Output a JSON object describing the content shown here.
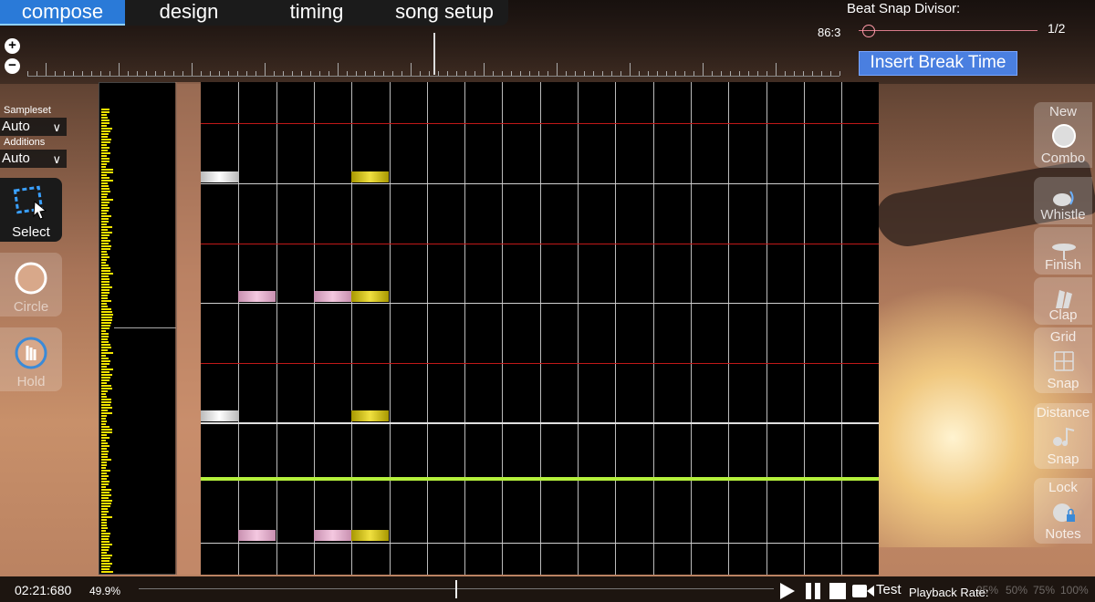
{
  "mode_tabs": [
    {
      "label": "compose",
      "active": true
    },
    {
      "label": "design",
      "active": false
    },
    {
      "label": "timing",
      "active": false
    },
    {
      "label": "song setup",
      "active": false
    }
  ],
  "beat_snap": {
    "title": "Beat Snap Divisor:",
    "bpm": "86:3",
    "value": "1/2"
  },
  "insert_break": "Insert Break Time",
  "zoom": {
    "in": "+",
    "out": "−"
  },
  "left_panel": {
    "sampleset_label": "Sampleset",
    "sampleset_value": "Auto",
    "additions_label": "Additions",
    "additions_value": "Auto",
    "tools": [
      {
        "label": "Select",
        "icon": "select-icon",
        "active": true
      },
      {
        "label": "Circle",
        "icon": "circle-icon",
        "active": false
      },
      {
        "label": "Hold",
        "icon": "hold-icon",
        "active": false
      }
    ]
  },
  "right_panel": {
    "tools": [
      {
        "top": "New",
        "bottom": "Combo",
        "icon": "new-combo-icon"
      },
      {
        "top": "",
        "bottom": "Whistle",
        "icon": "whistle-icon"
      },
      {
        "top": "",
        "bottom": "Finish",
        "icon": "finish-icon"
      },
      {
        "top": "",
        "bottom": "Clap",
        "icon": "clap-icon"
      },
      {
        "top": "Grid",
        "bottom": "Snap",
        "icon": "grid-snap-icon"
      },
      {
        "top": "Distance",
        "bottom": "Snap",
        "icon": "distance-snap-icon"
      },
      {
        "top": "Lock",
        "bottom": "Notes",
        "icon": "lock-notes-icon"
      }
    ]
  },
  "bottom_bar": {
    "time": "02:21:680",
    "progress_percent": "49.9%",
    "progress_fraction": 0.499,
    "test_label": "Test",
    "playback_rate_label": "Playback Rate:",
    "rates": [
      "25%",
      "50%",
      "75%",
      "100%"
    ]
  },
  "colors": {
    "tab_active": "#2a7ad8",
    "break_button": "#4a7fe0",
    "playhead": "#b4f03c",
    "beat_line_red": "#c01818",
    "note_white": "#ffffff",
    "note_pink": "#f4c8e0",
    "note_gold": "#f0e040"
  }
}
